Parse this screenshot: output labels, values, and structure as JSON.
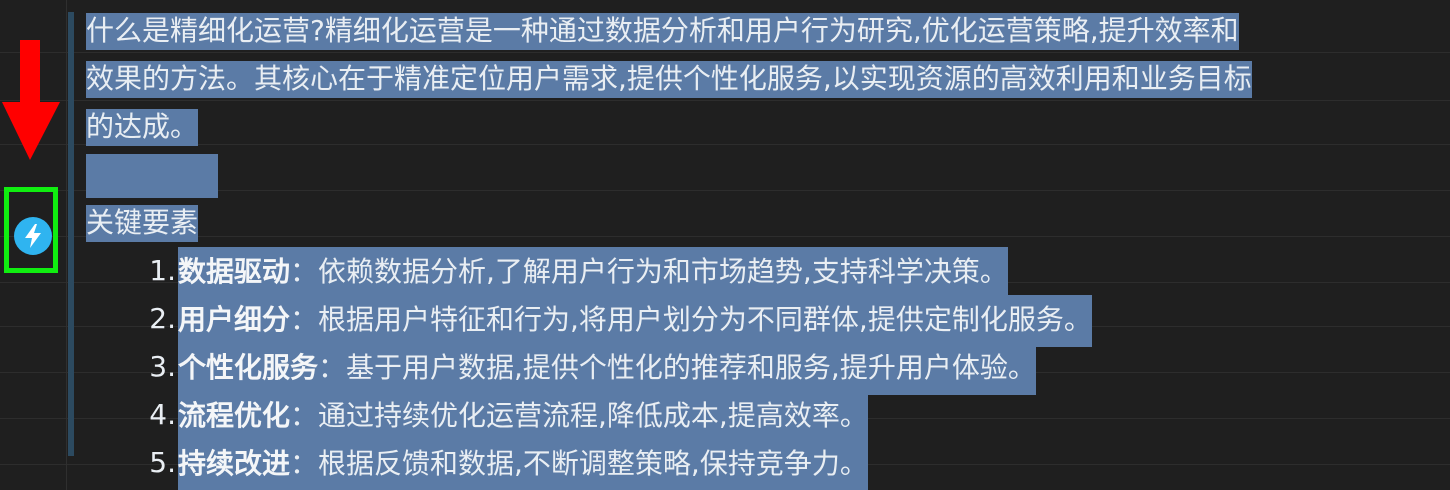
{
  "colors": {
    "background": "#1f1f1f",
    "selection": "#5b7ba6",
    "annotation_arrow": "#ff0000",
    "annotation_box": "#10ee10",
    "ai_button": "#2fb4f0"
  },
  "gutter": {
    "ai_button_icon": "lightning-icon"
  },
  "document": {
    "paragraph_lines": [
      "什么是精细化运营?精细化运营是一种通过数据分析和用户行为研究,优化运营策略,提升效率和",
      "效果的方法。其核心在于精准定位用户需求,提供个性化服务,以实现资源的高效利用和业务目标",
      "的达成。"
    ],
    "heading": "关键要素",
    "list": [
      {
        "num": "1.",
        "term": "数据驱动",
        "sep": "：",
        "desc": "依赖数据分析,了解用户行为和市场趋势,支持科学决策。"
      },
      {
        "num": "2.",
        "term": "用户细分",
        "sep": "：",
        "desc": "根据用户特征和行为,将用户划分为不同群体,提供定制化服务。"
      },
      {
        "num": "3.",
        "term": "个性化服务",
        "sep": "：",
        "desc": "基于用户数据,提供个性化的推荐和服务,提升用户体验。"
      },
      {
        "num": "4.",
        "term": "流程优化",
        "sep": "：",
        "desc": "通过持续优化运营流程,降低成本,提高效率。"
      },
      {
        "num": "5.",
        "term": "持续改进",
        "sep": "：",
        "desc": "根据反馈和数据,不断调整策略,保持竞争力。"
      }
    ]
  }
}
